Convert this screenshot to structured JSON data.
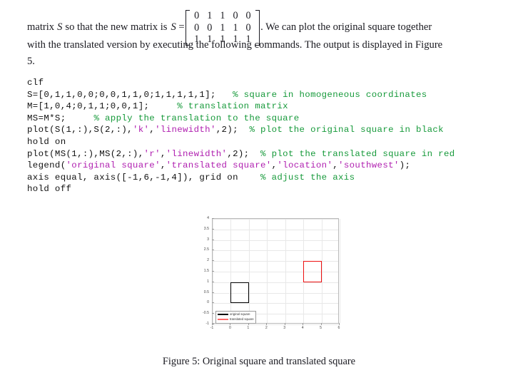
{
  "document": {
    "paragraph_lead": "matrix",
    "var_s_italic": "S",
    "paragraph_mid": "so that the new matrix is",
    "equals": "S =",
    "paragraph_after_matrix": ". We can plot the original square together",
    "paragraph_line2": "with the translated version by executing the following commands. The output is displayed in Figure",
    "paragraph_line3": "5."
  },
  "matrix": {
    "rows": [
      [
        "0",
        "1",
        "1",
        "0",
        "0"
      ],
      [
        "0",
        "0",
        "1",
        "1",
        "0"
      ],
      [
        "1",
        "1",
        "1",
        "1",
        "1"
      ]
    ]
  },
  "code": {
    "lines": [
      [
        {
          "t": "clf",
          "c": "key"
        }
      ],
      [
        {
          "t": "S=[0,1,1,0,0;0,0,1,1,0;1,1,1,1,1];   ",
          "c": "key"
        },
        {
          "t": "% square in homogeneous coordinates",
          "c": "com"
        }
      ],
      [
        {
          "t": "M=[1,0,4;0,1,1;0,0,1];     ",
          "c": "key"
        },
        {
          "t": "% translation matrix",
          "c": "com"
        }
      ],
      [
        {
          "t": "MS=M*S;     ",
          "c": "key"
        },
        {
          "t": "% apply the translation to the square",
          "c": "com"
        }
      ],
      [
        {
          "t": "plot(S(1,:),S(2,:),",
          "c": "key"
        },
        {
          "t": "'k'",
          "c": "str"
        },
        {
          "t": ",",
          "c": "key"
        },
        {
          "t": "'linewidth'",
          "c": "str"
        },
        {
          "t": ",2);  ",
          "c": "key"
        },
        {
          "t": "% plot the original square in black",
          "c": "com"
        }
      ],
      [
        {
          "t": "hold on",
          "c": "key"
        }
      ],
      [
        {
          "t": "plot(MS(1,:),MS(2,:),",
          "c": "key"
        },
        {
          "t": "'r'",
          "c": "str"
        },
        {
          "t": ",",
          "c": "key"
        },
        {
          "t": "'linewidth'",
          "c": "str"
        },
        {
          "t": ",2);  ",
          "c": "key"
        },
        {
          "t": "% plot the translated square in red",
          "c": "com"
        }
      ],
      [
        {
          "t": "legend(",
          "c": "key"
        },
        {
          "t": "'original square'",
          "c": "str"
        },
        {
          "t": ",",
          "c": "key"
        },
        {
          "t": "'translated square'",
          "c": "str"
        },
        {
          "t": ",",
          "c": "key"
        },
        {
          "t": "'location'",
          "c": "str"
        },
        {
          "t": ",",
          "c": "key"
        },
        {
          "t": "'southwest'",
          "c": "str"
        },
        {
          "t": ");",
          "c": "key"
        }
      ],
      [
        {
          "t": "axis equal, axis([-1,6,-1,4]), grid on    ",
          "c": "key"
        },
        {
          "t": "% adjust the axis",
          "c": "com"
        }
      ],
      [
        {
          "t": "hold off",
          "c": "key"
        }
      ]
    ]
  },
  "chart_data": {
    "type": "line",
    "title": "",
    "xlabel": "",
    "ylabel": "",
    "xlim": [
      -1,
      6
    ],
    "ylim": [
      -1,
      4
    ],
    "grid": true,
    "axis_equal": true,
    "xticks": [
      "-1",
      "0",
      "1",
      "2",
      "3",
      "4",
      "5",
      "6"
    ],
    "xtick_values": [
      -1,
      0,
      1,
      2,
      3,
      4,
      5,
      6
    ],
    "yticks": [
      "-1",
      "-0.5",
      "0",
      "0.5",
      "1",
      "1.5",
      "2",
      "2.5",
      "3",
      "3.5",
      "4"
    ],
    "ytick_values": [
      -1,
      -0.5,
      0,
      0.5,
      1,
      1.5,
      2,
      2.5,
      3,
      3.5,
      4
    ],
    "legend_position": "southwest",
    "series": [
      {
        "name": "original square",
        "color": "#000000",
        "linewidth": 2,
        "x": [
          0,
          1,
          1,
          0,
          0
        ],
        "y": [
          0,
          0,
          1,
          1,
          0
        ],
        "bounds": {
          "x0": 0,
          "y0": 0,
          "x1": 1,
          "y1": 1
        }
      },
      {
        "name": "translated square",
        "color": "#ee1111",
        "linewidth": 2,
        "x": [
          4,
          5,
          5,
          4,
          4
        ],
        "y": [
          1,
          1,
          2,
          2,
          1
        ],
        "bounds": {
          "x0": 4,
          "y0": 1,
          "x1": 5,
          "y1": 2
        }
      }
    ]
  },
  "caption": {
    "text": "Figure 5: Original square and translated square"
  }
}
